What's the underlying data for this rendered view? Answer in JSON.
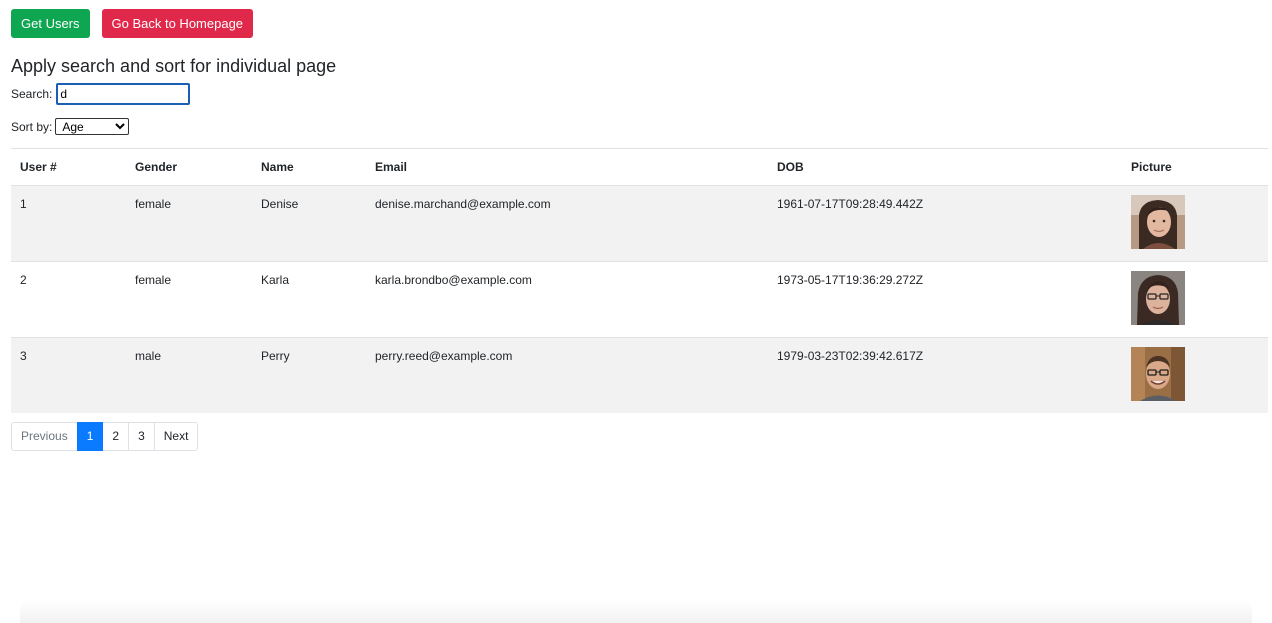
{
  "toolbar": {
    "get_users_label": "Get Users",
    "homepage_label": "Go Back to Homepage"
  },
  "colors": {
    "success": "#0fa652",
    "danger": "#e0284a",
    "active_page": "#0a7bff",
    "striped_row": "#f2f2f2"
  },
  "main": {
    "heading": "Apply search and sort for individual page",
    "search": {
      "label": "Search:",
      "value": "d"
    },
    "sort": {
      "label": "Sort by:",
      "selected": "Age"
    }
  },
  "table": {
    "headers": [
      "User #",
      "Gender",
      "Name",
      "Email",
      "DOB",
      "Picture"
    ],
    "rows": [
      {
        "num": "1",
        "gender": "female",
        "name": "Denise",
        "email": "denise.marchand@example.com",
        "dob": "1961-07-17T09:28:49.442Z",
        "picture": "portrait-photo"
      },
      {
        "num": "2",
        "gender": "female",
        "name": "Karla",
        "email": "karla.brondbo@example.com",
        "dob": "1973-05-17T19:36:29.272Z",
        "picture": "portrait-photo"
      },
      {
        "num": "3",
        "gender": "male",
        "name": "Perry",
        "email": "perry.reed@example.com",
        "dob": "1979-03-23T02:39:42.617Z",
        "picture": "portrait-photo"
      }
    ]
  },
  "pagination": {
    "previous": "Previous",
    "pages": [
      "1",
      "2",
      "3"
    ],
    "active_page": "1",
    "next": "Next"
  }
}
